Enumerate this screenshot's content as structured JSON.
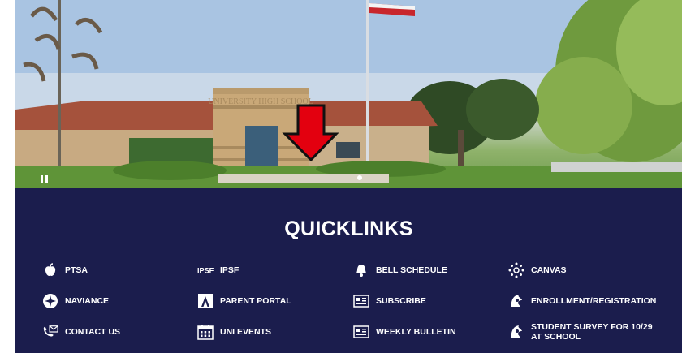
{
  "hero": {
    "building_sign": "UNIVERSITY HIGH SCHOOL"
  },
  "quicklinks": {
    "title": "QUICKLINKS",
    "items": [
      {
        "label": "PTSA",
        "icon": "apple-icon"
      },
      {
        "label": "IPSF",
        "icon": "ipsf-logo-icon"
      },
      {
        "label": "BELL SCHEDULE",
        "icon": "bell-icon"
      },
      {
        "label": "CANVAS",
        "icon": "canvas-icon"
      },
      {
        "label": "NAVIANCE",
        "icon": "compass-icon"
      },
      {
        "label": "PARENT PORTAL",
        "icon": "portal-icon"
      },
      {
        "label": "SUBSCRIBE",
        "icon": "newsletter-icon"
      },
      {
        "label": "ENROLLMENT/REGISTRATION",
        "icon": "trojan-icon"
      },
      {
        "label": "CONTACT US",
        "icon": "phone-mail-icon"
      },
      {
        "label": "UNI EVENTS",
        "icon": "calendar-icon"
      },
      {
        "label": "WEEKLY BULLETIN",
        "icon": "newsletter-icon"
      },
      {
        "label": "STUDENT SURVEY FOR 10/29 AT SCHOOL",
        "icon": "trojan-icon"
      }
    ]
  },
  "colors": {
    "quicklinks_bg": "#1b1d4d",
    "arrow": "#e3000f"
  }
}
